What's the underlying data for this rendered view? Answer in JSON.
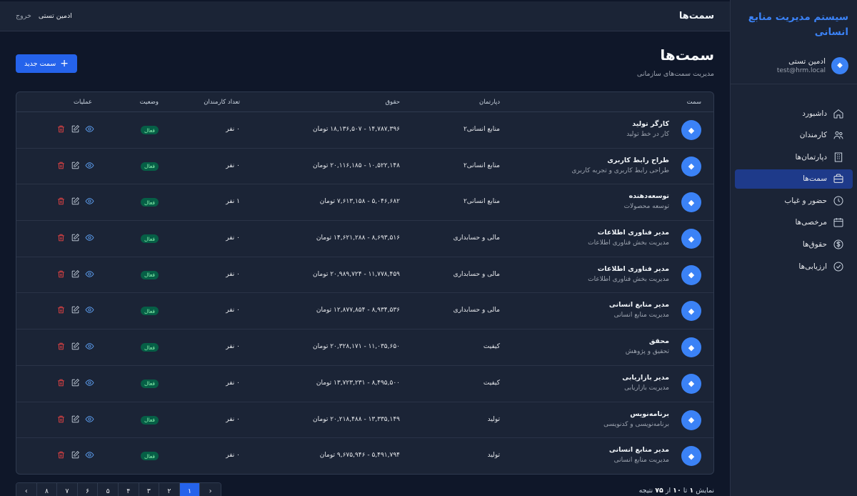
{
  "app": {
    "brand": "سیستم مدیریت منابع انسانی"
  },
  "user": {
    "name": "ادمین تستی",
    "email": "test@hrm.local"
  },
  "nav": [
    {
      "label": "داشبورد",
      "icon": "home-icon"
    },
    {
      "label": "کارمندان",
      "icon": "users-icon"
    },
    {
      "label": "دپارتمان‌ها",
      "icon": "building-icon"
    },
    {
      "label": "سمت‌ها",
      "icon": "briefcase-icon",
      "active": true
    },
    {
      "label": "حضور و غیاب",
      "icon": "clock-icon"
    },
    {
      "label": "مرخصی‌ها",
      "icon": "calendar-icon"
    },
    {
      "label": "حقوق‌ها",
      "icon": "dollar-icon"
    },
    {
      "label": "ارزیابی‌ها",
      "icon": "check-circle-icon"
    }
  ],
  "topbar": {
    "title": "سمت‌ها",
    "user": "ادمین تستی",
    "logout": "خروج"
  },
  "page": {
    "title": "سمت‌ها",
    "subtitle": "مدیریت سمت‌های سازمانی",
    "new_button": "سمت جدید"
  },
  "table": {
    "headers": {
      "position": "سمت",
      "department": "دپارتمان",
      "salary": "حقوق",
      "count": "تعداد کارمندان",
      "status": "وضعیت",
      "actions": "عملیات"
    },
    "rows": [
      {
        "title": "کارگر تولید",
        "desc": "کار در خط تولید",
        "dept": "منابع انسانی۲",
        "salary": "۱۴,۷۸۷,۳۹۶ - ۱۸,۱۳۶,۵۰۷ تومان",
        "count": "۰ نفر",
        "status": "فعال"
      },
      {
        "title": "طراح رابط کاربری",
        "desc": "طراحی رابط کاربری و تجربه کاربری",
        "dept": "منابع انسانی۲",
        "salary": "۱۰,۵۲۲,۱۴۸ - ۲۰,۱۱۶,۱۸۵ تومان",
        "count": "۰ نفر",
        "status": "فعال"
      },
      {
        "title": "توسعه‌دهنده",
        "desc": "توسعه محصولات",
        "dept": "منابع انسانی۲",
        "salary": "۵,۰۴۶,۶۸۲ - ۷,۶۱۳,۱۵۸ تومان",
        "count": "۱ نفر",
        "status": "فعال"
      },
      {
        "title": "مدیر فناوری اطلاعات",
        "desc": "مدیریت بخش فناوری اطلاعات",
        "dept": "مالی و حسابداری",
        "salary": "۸,۶۹۳,۵۱۶ - ۱۴,۶۲۱,۲۸۸ تومان",
        "count": "۰ نفر",
        "status": "فعال"
      },
      {
        "title": "مدیر فناوری اطلاعات",
        "desc": "مدیریت بخش فناوری اطلاعات",
        "dept": "مالی و حسابداری",
        "salary": "۱۱,۷۷۸,۴۵۹ - ۲۰,۹۸۹,۷۲۴ تومان",
        "count": "۰ نفر",
        "status": "فعال"
      },
      {
        "title": "مدیر منابع انسانی",
        "desc": "مدیریت منابع انسانی",
        "dept": "مالی و حسابداری",
        "salary": "۸,۹۳۴,۵۳۶ - ۱۲,۸۷۷,۸۵۴ تومان",
        "count": "۰ نفر",
        "status": "فعال"
      },
      {
        "title": "محقق",
        "desc": "تحقیق و پژوهش",
        "dept": "کیفیت",
        "salary": "۱۱,۰۳۵,۶۵۰ - ۲۰,۳۲۸,۱۷۱ تومان",
        "count": "۰ نفر",
        "status": "فعال"
      },
      {
        "title": "مدیر بازاریابی",
        "desc": "مدیریت بازاریابی",
        "dept": "کیفیت",
        "salary": "۸,۴۹۵,۵۰۰ - ۱۳,۷۲۳,۲۳۱ تومان",
        "count": "۰ نفر",
        "status": "فعال"
      },
      {
        "title": "برنامه‌نویس",
        "desc": "برنامه‌نویسی و کدنویسی",
        "dept": "تولید",
        "salary": "۱۳,۳۳۵,۱۴۹ - ۲۰,۲۱۸,۴۸۸ تومان",
        "count": "۰ نفر",
        "status": "فعال"
      },
      {
        "title": "مدیر منابع انسانی",
        "desc": "مدیریت منابع انسانی",
        "dept": "تولید",
        "salary": "۵,۴۹۱,۷۹۴ - ۹,۶۷۵,۹۴۶ تومان",
        "count": "۰ نفر",
        "status": "فعال"
      }
    ]
  },
  "pagination": {
    "pages": [
      "‹",
      "۱",
      "۲",
      "۳",
      "۴",
      "۵",
      "۶",
      "۷",
      "۸",
      "›"
    ],
    "active_index": 1,
    "info_prefix": "نمایش",
    "from": "۱",
    "to_word": "تا",
    "to": "۱۰",
    "of_word": "از",
    "total": "۷۵",
    "suffix": "نتیجه"
  }
}
